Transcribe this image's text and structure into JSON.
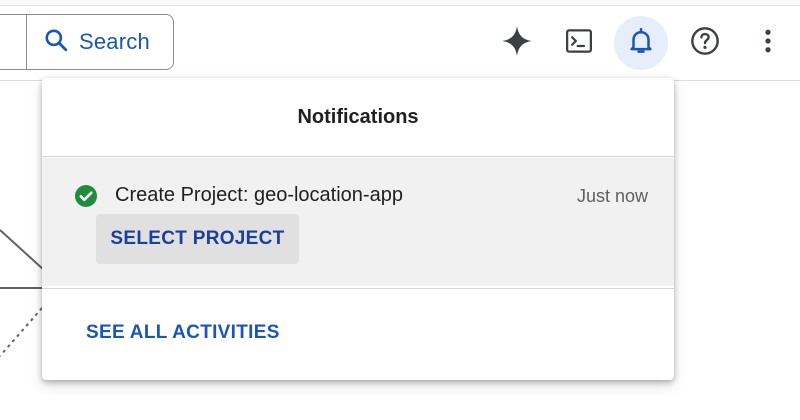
{
  "header": {
    "search_label": "Search",
    "icons": [
      "search-icon",
      "gemini-spark-icon",
      "cloud-shell-terminal-icon",
      "notifications-bell-icon",
      "help-icon",
      "more-vert-icon"
    ]
  },
  "notifications": {
    "title": "Notifications",
    "items": [
      {
        "status": "success",
        "status_icon": "check-circle-icon",
        "message": "Create Project: geo-location-app",
        "time": "Just now",
        "action_label": "SELECT PROJECT"
      }
    ],
    "footer_link": "SEE ALL ACTIVITIES"
  },
  "colors": {
    "accent": "#1a56b8",
    "success": "#1e8e3e",
    "active_icon_bg": "#e7eefb",
    "item_bg": "#f1f1f1"
  }
}
